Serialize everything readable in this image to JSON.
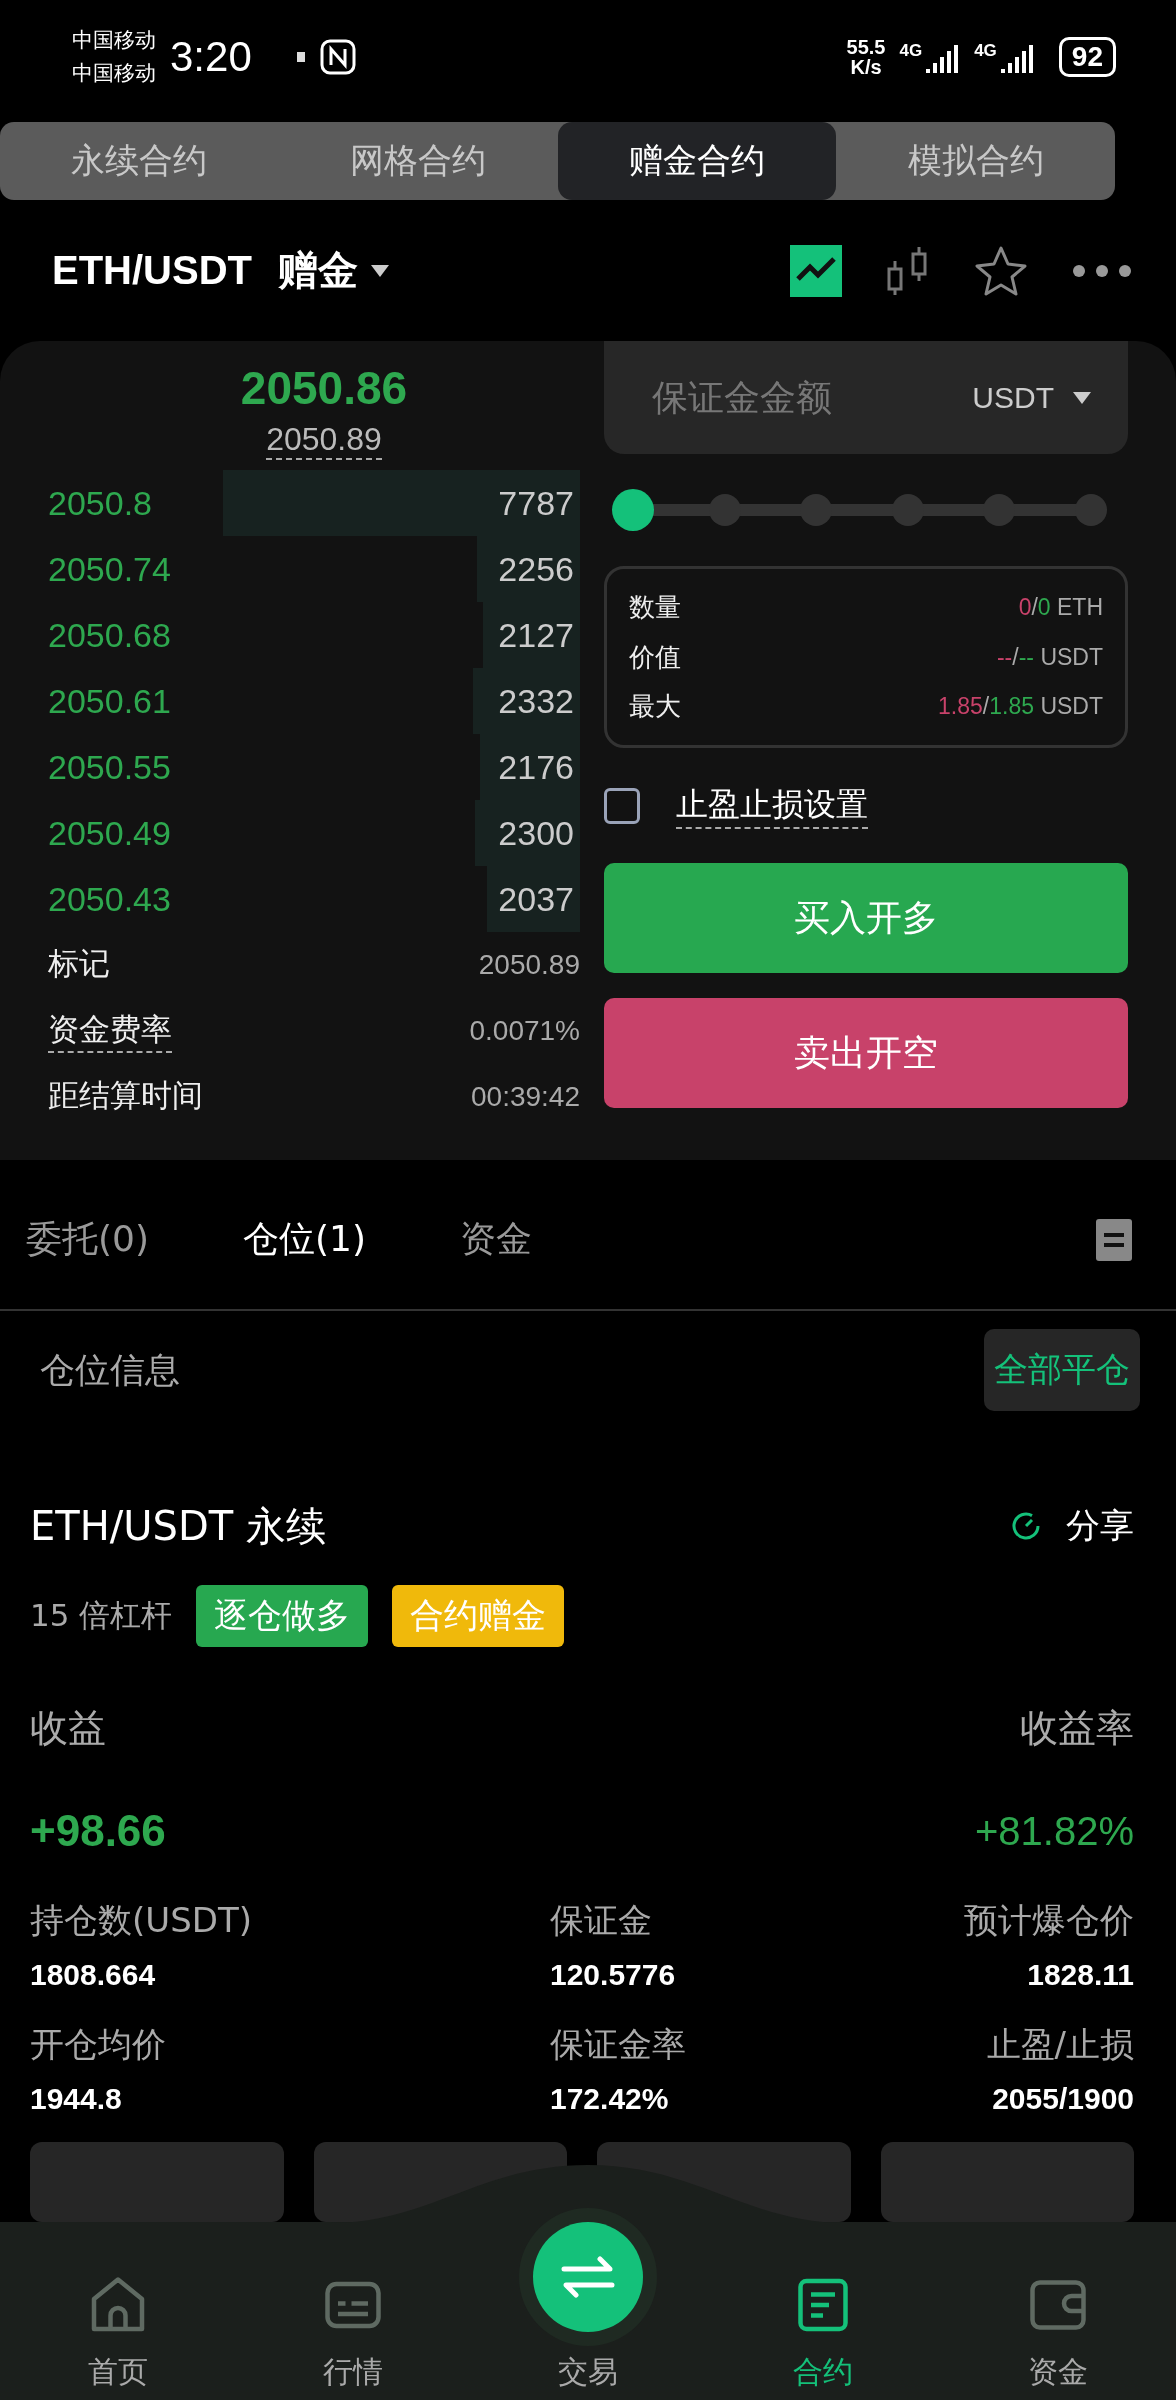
{
  "status_bar": {
    "carriers": [
      "中国移动",
      "中国移动"
    ],
    "time": "3:20",
    "net_speed": [
      "55.5",
      "K/s"
    ],
    "network": [
      "4G",
      "4G"
    ],
    "battery": "92"
  },
  "mode_tabs": [
    {
      "label": "永续合约",
      "selected": false
    },
    {
      "label": "网格合约",
      "selected": false
    },
    {
      "label": "赠金合约",
      "selected": true
    },
    {
      "label": "模拟合约",
      "selected": false
    }
  ],
  "header": {
    "pair": "ETH/USDT",
    "mode": "赠金"
  },
  "order_book": {
    "last_price": "2050.86",
    "mark_price": "2050.89",
    "rows": [
      {
        "price": "2050.8",
        "qty": "7787"
      },
      {
        "price": "2050.74",
        "qty": "2256"
      },
      {
        "price": "2050.68",
        "qty": "2127"
      },
      {
        "price": "2050.61",
        "qty": "2332"
      },
      {
        "price": "2050.55",
        "qty": "2176"
      },
      {
        "price": "2050.49",
        "qty": "2300"
      },
      {
        "price": "2050.43",
        "qty": "2037"
      }
    ]
  },
  "stats": [
    {
      "label": "标记",
      "value": "2050.89",
      "underlined": false
    },
    {
      "label": "资金费率",
      "value": "0.0071%",
      "underlined": true
    },
    {
      "label": "距结算时间",
      "value": "00:39:42",
      "underlined": false
    }
  ],
  "order_form": {
    "amount_placeholder": "保证金金额",
    "unit": "USDT",
    "leverage_slider": {
      "level": 0
    },
    "summary": [
      {
        "label": "数量",
        "first": "0",
        "separator": "/",
        "second": "0",
        "unit": "ETH"
      },
      {
        "label": "价值",
        "first": "--",
        "separator": "/",
        "second": "--",
        "unit": "USDT"
      },
      {
        "label": "最大",
        "first": "1.85",
        "separator": "/",
        "second": "1.85",
        "unit": "USDT"
      }
    ],
    "tp_sl": {
      "label": "止盈止损设置",
      "checked": false
    },
    "buttons": [
      {
        "label": "买入开多",
        "kind": "buy"
      },
      {
        "label": "卖出开空",
        "kind": "sell"
      }
    ]
  },
  "position_tabs": [
    {
      "label": "委托(0)",
      "selected": false
    },
    {
      "label": "仓位(1)",
      "selected": true
    },
    {
      "label": "资金",
      "selected": false
    }
  ],
  "position": {
    "section_title": "仓位信息",
    "close_all": "全部平仓",
    "symbol": "ETH/USDT 永续",
    "share": "分享",
    "leverage": "15 倍杠杆",
    "tags": [
      {
        "label": "逐仓做多",
        "color": "#27a850"
      },
      {
        "label": "合约赠金",
        "color": "#f0b90b"
      }
    ],
    "pnl_label": "收益",
    "pnl": "+98.66",
    "roe_label": "收益率",
    "roe": "+81.82%",
    "fields": [
      {
        "label": "持仓数(USDT)",
        "value": "1808.664"
      },
      {
        "label": "保证金",
        "value": "120.5776"
      },
      {
        "label": "预计爆仓价",
        "value": "1828.11"
      },
      {
        "label": "开仓均价",
        "value": "1944.8"
      },
      {
        "label": "保证金率",
        "value": "172.42%"
      },
      {
        "label": "止盈/止损",
        "value": "2055/1900"
      }
    ]
  },
  "bottom_nav": [
    {
      "label": "首页",
      "kind": "home",
      "selected": false
    },
    {
      "label": "行情",
      "kind": "market",
      "selected": false
    },
    {
      "label": "交易",
      "kind": "trade",
      "selected": false
    },
    {
      "label": "合约",
      "kind": "contract",
      "selected": true
    },
    {
      "label": "资金",
      "kind": "wallet",
      "selected": false
    }
  ]
}
